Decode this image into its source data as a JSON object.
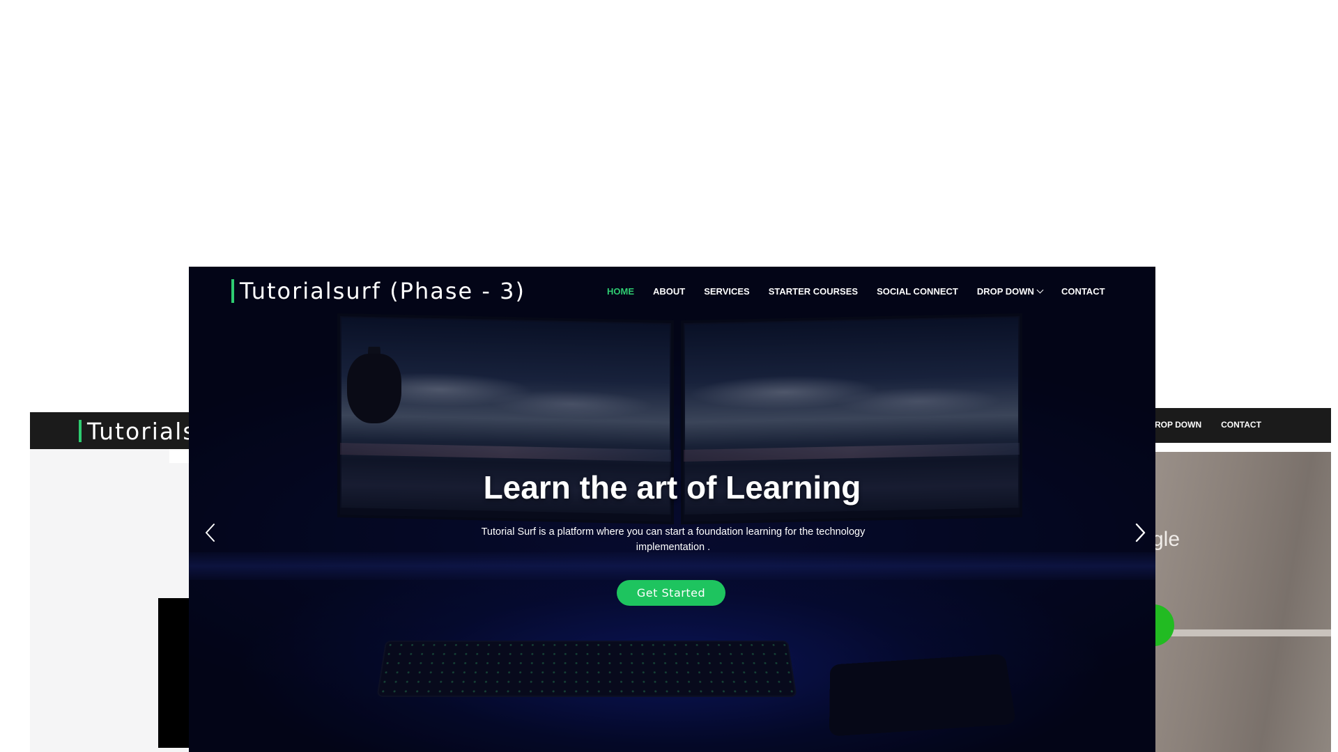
{
  "background_left": {
    "brand": "Tutorials"
  },
  "background_right": {
    "nav": [
      "ROP DOWN",
      "CONTACT"
    ],
    "photo_text": "gle"
  },
  "hero": {
    "brand": "Tutorialsurf (Phase - 3)",
    "nav": [
      {
        "label": "HOME",
        "active": true
      },
      {
        "label": "ABOUT"
      },
      {
        "label": "SERVICES"
      },
      {
        "label": "STARTER COURSES"
      },
      {
        "label": "SOCIAL CONNECT"
      },
      {
        "label": "DROP DOWN"
      },
      {
        "label": "CONTACT"
      }
    ],
    "headline": "Learn the art of Learning",
    "subtext": "Tutorial Surf is a platform where you can start a foundation learning for the technology implementation .",
    "cta": "Get Started",
    "icons": {
      "prev": "chevron-left-icon",
      "next": "chevron-right-icon",
      "dropdown": "chevron-down-icon"
    }
  },
  "colors": {
    "accent": "#2ecc71",
    "button": "#1ec45f",
    "navbar": "#1b1b1b",
    "hero_bg": "#05071a"
  }
}
